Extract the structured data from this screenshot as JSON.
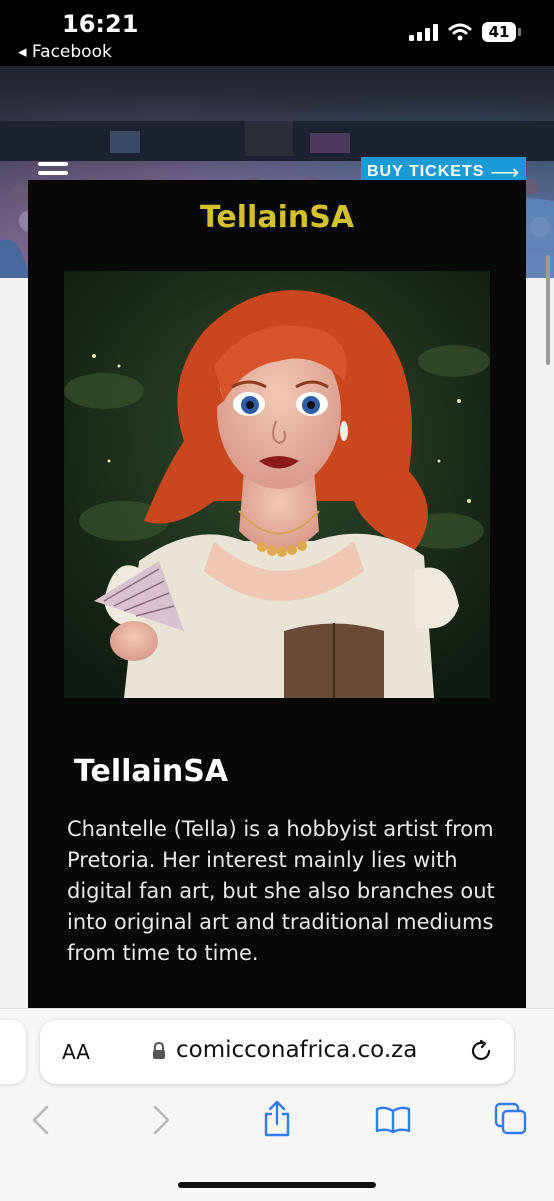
{
  "status": {
    "time": "16:21",
    "back_label": "◂ Facebook",
    "battery": "41"
  },
  "header": {
    "buy_tickets_label": "BUY TICKETS",
    "arrow": "⟶"
  },
  "card": {
    "title": "TellainSA",
    "artist_name": "TellainSA",
    "bio": "Chantelle (Tella) is a hobbyist artist from Pretoria. Her interest mainly lies with digital fan art, but she also branches out into original art and traditional mediums from time to time."
  },
  "browser": {
    "aa_label": "AA",
    "url": "comicconafrica.co.za"
  },
  "colors": {
    "accent_yellow": "#d4c12a",
    "button_blue": "#1a9ad6",
    "card_bg": "#080808",
    "ios_blue": "#2f7cf6"
  },
  "icons": [
    "hamburger-menu-icon",
    "arrow-right-icon",
    "lock-icon",
    "reload-icon",
    "back-icon",
    "forward-icon",
    "share-icon",
    "bookmarks-icon",
    "tabs-icon",
    "wifi-icon",
    "signal-icon"
  ]
}
